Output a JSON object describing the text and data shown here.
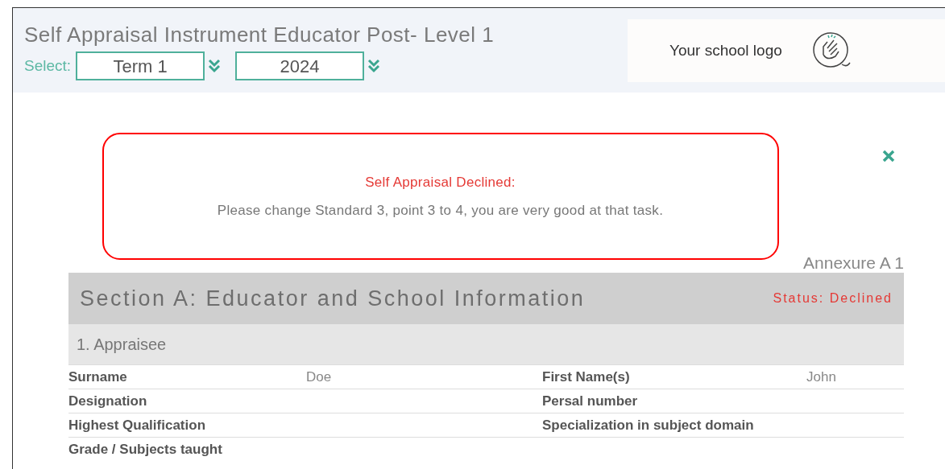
{
  "header": {
    "title": "Self Appraisal Instrument Educator Post- Level 1",
    "select_label": "Select:",
    "selects": [
      {
        "value": "Term 1"
      },
      {
        "value": "2024"
      }
    ]
  },
  "logo": {
    "text": "Your school logo"
  },
  "alert": {
    "title": "Self Appraisal Declined:",
    "message": "Please change Standard 3, point 3 to 4, you are very good at that task."
  },
  "annexure": "Annexure A 1",
  "section": {
    "title": "Section A: Educator and School Information",
    "status": "Status: Declined",
    "subsection": "1. Appraisee",
    "rows": [
      {
        "label_1": "Surname",
        "value_1": "Doe",
        "label_2": "First Name(s)",
        "value_2": "John"
      },
      {
        "label_1": "Designation",
        "label_2": "Persal number"
      },
      {
        "label_1": "Highest Qualification",
        "label_2": "Specialization in subject domain"
      },
      {
        "label_1": "Grade / Subjects taught"
      }
    ]
  }
}
